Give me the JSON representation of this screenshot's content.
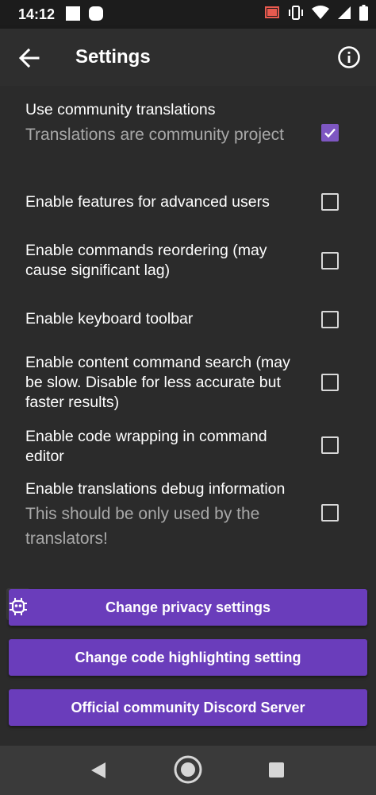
{
  "status_bar": {
    "time": "14:12"
  },
  "app_bar": {
    "title": "Settings",
    "back_icon": "arrow-back-icon",
    "info_icon": "info-icon"
  },
  "settings": [
    {
      "title": "Use community translations",
      "subtitle": "Translations are community project",
      "checked": true
    },
    {
      "title": "Enable features for advanced users",
      "subtitle": "",
      "checked": false
    },
    {
      "title": "Enable commands reordering (may cause significant lag)",
      "subtitle": "",
      "checked": false
    },
    {
      "title": "Enable keyboard toolbar",
      "subtitle": "",
      "checked": false
    },
    {
      "title": "Enable content command search (may be slow. Disable for less accurate but faster results)",
      "subtitle": "",
      "checked": false
    },
    {
      "title": "Enable code wrapping in command editor",
      "subtitle": "",
      "checked": false
    },
    {
      "title": "Enable translations debug information",
      "subtitle": "This should be only used by the translators!",
      "checked": false
    }
  ],
  "buttons": {
    "privacy": "Change privacy settings",
    "highlighting": "Change code highlighting setting",
    "discord": "Official community Discord Server"
  },
  "colors": {
    "accent": "#6a3dbb",
    "checkbox_checked": "#7e57c2",
    "background": "#2b2b2b"
  }
}
